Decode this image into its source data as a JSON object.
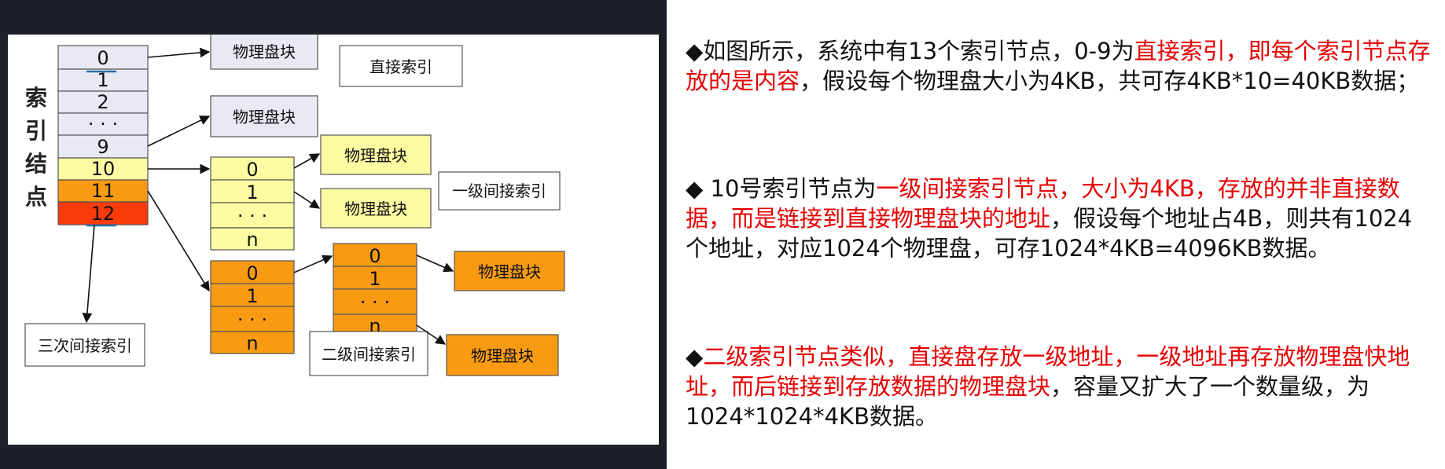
{
  "colors": {
    "gray_cell": "#e9e9f3",
    "yellow_cell": "#fdfca2",
    "orange_cell": "#f99b12",
    "red_cell": "#fc3b0a",
    "text_red": "#e60000"
  },
  "diagram": {
    "vertical_label": [
      "索",
      "引",
      "结",
      "点"
    ],
    "index_cells": [
      "0",
      "1",
      "2",
      "· · ·",
      "9",
      "10",
      "11",
      "12"
    ],
    "block_label": "物理盘块",
    "yellow_table_cells": [
      "0",
      "1",
      "· · ·",
      "n"
    ],
    "orange_table1_cells": [
      "0",
      "1",
      "· · ·",
      "n"
    ],
    "orange_table2_cells": [
      "0",
      "1",
      "· · ·",
      "n"
    ],
    "direct_index_label": "直接索引",
    "single_indirect_label": "一级间接索引",
    "double_indirect_label": "二级间接索引",
    "triple_indirect_label": "三次间接索引"
  },
  "text": {
    "p1": [
      {
        "t": "◆如图所示，系统中有13个索引节点，0-9为",
        "red": false
      },
      {
        "t": "直接索引，即每个索引节点存放的是内容",
        "red": true
      },
      {
        "t": "，假设每个物理盘大小为4KB，共可存4KB*10=40KB数据；",
        "red": false
      }
    ],
    "p2": [
      {
        "t": "◆  10号索引节点为",
        "red": false
      },
      {
        "t": "一级间接索引节点，大小为4KB，存放的并非直接数据，而是链接到直接物理盘块的地址",
        "red": true
      },
      {
        "t": "，假设每个地址占4B，则共有1024个地址，对应1024个物理盘，可存1024*4KB=4096KB数据。",
        "red": false
      }
    ],
    "p3": [
      {
        "t": "◆",
        "red": false
      },
      {
        "t": "二级索引节点类似，直接盘存放一级地址，一级地址再存放物理盘快地址，而后链接到存放数据的物理盘块",
        "red": true
      },
      {
        "t": "，容量又扩大了一个数量级，为1024*1024*4KB数据。",
        "red": false
      }
    ]
  }
}
